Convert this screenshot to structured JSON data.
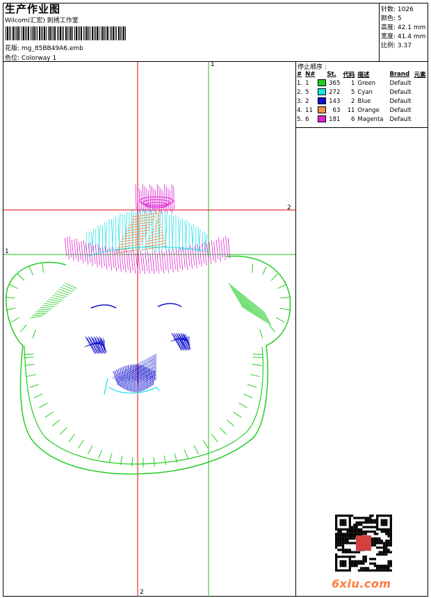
{
  "header": {
    "title": "生产作业图",
    "subtitle": "Wilcom(汇宏) 刺绣工作室",
    "design_label": "花版: ",
    "design_file": "mg_85BB49A6.emb",
    "color_label": "色位: ",
    "colorway": "Colorway 1"
  },
  "stats": [
    {
      "label": "针数",
      "value": "1026"
    },
    {
      "label": "颜色",
      "value": "5"
    },
    {
      "label": "高度",
      "value": "42.1 mm"
    },
    {
      "label": "宽度",
      "value": "41.4 mm"
    },
    {
      "label": "比例",
      "value": "3.37"
    }
  ],
  "stop_sequence": {
    "title": "停止顺序 :",
    "headers": [
      "#",
      "N#",
      "St.",
      "代码",
      "描述",
      "Brand",
      "元素"
    ],
    "rows": [
      {
        "idx": "1.",
        "n": "1",
        "color": "#22cc22",
        "stitches": "365",
        "code": "1",
        "name": "Green",
        "brand": "Default"
      },
      {
        "idx": "2.",
        "n": "5",
        "color": "#22e0e8",
        "stitches": "272",
        "code": "5",
        "name": "Cyan",
        "brand": "Default"
      },
      {
        "idx": "3.",
        "n": "2",
        "color": "#1010cc",
        "stitches": "143",
        "code": "2",
        "name": "Blue",
        "brand": "Default"
      },
      {
        "idx": "4.",
        "n": "11",
        "color": "#f09050",
        "stitches": "63",
        "code": "11",
        "name": "Orange",
        "brand": "Default"
      },
      {
        "idx": "5.",
        "n": "6",
        "color": "#e020d0",
        "stitches": "181",
        "code": "6",
        "name": "Magenta",
        "brand": "Default"
      }
    ]
  },
  "guides": {
    "v1": "1",
    "h1": "1",
    "v2": "2",
    "h2": "2"
  },
  "watermark": {
    "site": "6xiu.com"
  },
  "palette": {
    "green": "#22cc22",
    "cyan": "#22e0e8",
    "blue": "#1010cc",
    "orange": "#f09050",
    "magenta": "#e020d0",
    "red_guide": "#e00000",
    "green_guide": "#20c020"
  }
}
